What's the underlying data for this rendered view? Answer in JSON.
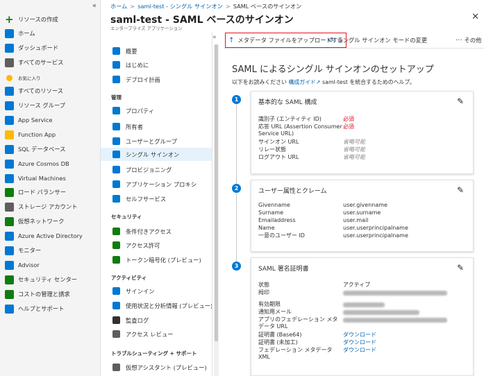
{
  "left_nav": {
    "collapse": "«",
    "items": [
      {
        "label": "リソースの作成",
        "icon": "plus-icon",
        "color": "#107c10"
      },
      {
        "label": "ホーム",
        "icon": "home-icon",
        "color": "#0078d4"
      },
      {
        "label": "ダッシュボード",
        "icon": "dashboard-icon",
        "color": "#0078d4"
      },
      {
        "label": "すべてのサービス",
        "icon": "list-icon",
        "color": "#605e5c"
      },
      {
        "label": "お気に入り",
        "icon": "star-icon",
        "color": "#ffb900"
      },
      {
        "label": "すべてのリソース",
        "icon": "grid-icon",
        "color": "#0078d4"
      },
      {
        "label": "リソース グループ",
        "icon": "resource-group-icon",
        "color": "#0078d4"
      },
      {
        "label": "App Service",
        "icon": "app-service-icon",
        "color": "#0078d4"
      },
      {
        "label": "Function App",
        "icon": "function-app-icon",
        "color": "#ffb900"
      },
      {
        "label": "SQL データベース",
        "icon": "sql-database-icon",
        "color": "#0078d4"
      },
      {
        "label": "Azure Cosmos DB",
        "icon": "cosmos-db-icon",
        "color": "#0078d4"
      },
      {
        "label": "Virtual Machines",
        "icon": "virtual-machine-icon",
        "color": "#0078d4"
      },
      {
        "label": "ロード バランサー",
        "icon": "load-balancer-icon",
        "color": "#107c10"
      },
      {
        "label": "ストレージ アカウント",
        "icon": "storage-account-icon",
        "color": "#605e5c"
      },
      {
        "label": "仮想ネットワーク",
        "icon": "virtual-network-icon",
        "color": "#107c10"
      },
      {
        "label": "Azure Active Directory",
        "icon": "active-directory-icon",
        "color": "#0078d4"
      },
      {
        "label": "モニター",
        "icon": "monitor-icon",
        "color": "#0078d4"
      },
      {
        "label": "Advisor",
        "icon": "advisor-icon",
        "color": "#0078d4"
      },
      {
        "label": "セキュリティ センター",
        "icon": "security-center-icon",
        "color": "#107c10"
      },
      {
        "label": "コストの管理と請求",
        "icon": "cost-management-icon",
        "color": "#107c10"
      },
      {
        "label": "ヘルプとサポート",
        "icon": "help-icon",
        "color": "#0078d4"
      }
    ]
  },
  "breadcrumb": [
    "ホーム",
    "saml-test - シングル サインオン",
    "SAML ベースのサインオン"
  ],
  "header": {
    "title": "saml-test - SAML ベースのサインオン",
    "subtitle": "エンタープライズ アプリケーション",
    "close": "✕"
  },
  "menu": {
    "collapse": "«",
    "items": [
      {
        "label": "概要",
        "icon": "grid-icon",
        "color": "#0078d4"
      },
      {
        "label": "はじめに",
        "icon": "rocket-icon",
        "color": "#0078d4"
      },
      {
        "label": "デプロイ計画",
        "icon": "book-icon",
        "color": "#0078d4"
      },
      {
        "label": "管理",
        "section": true
      },
      {
        "label": "プロパティ",
        "icon": "properties-icon",
        "color": "#0078d4"
      },
      {
        "label": "所有者",
        "icon": "owners-icon",
        "color": "#0078d4"
      },
      {
        "label": "ユーザーとグループ",
        "icon": "users-icon",
        "color": "#0078d4"
      },
      {
        "label": "シングル サインオン",
        "icon": "sso-icon",
        "color": "#0078d4",
        "active": true
      },
      {
        "label": "プロビジョニング",
        "icon": "provisioning-icon",
        "color": "#0078d4"
      },
      {
        "label": "アプリケーション プロキシ",
        "icon": "proxy-icon",
        "color": "#0078d4"
      },
      {
        "label": "セルフサービス",
        "icon": "self-service-icon",
        "color": "#0078d4"
      },
      {
        "label": "セキュリティ",
        "section": true
      },
      {
        "label": "条件付きアクセス",
        "icon": "conditional-access-icon",
        "color": "#107c10"
      },
      {
        "label": "アクセス許可",
        "icon": "permissions-icon",
        "color": "#107c10"
      },
      {
        "label": "トークン暗号化 (プレビュー)",
        "icon": "token-encryption-icon",
        "color": "#107c10"
      },
      {
        "label": "アクティビティ",
        "section": true
      },
      {
        "label": "サインイン",
        "icon": "sign-in-icon",
        "color": "#0078d4"
      },
      {
        "label": "使用状況と分析情報 (プレビュー)",
        "icon": "usage-chart-icon",
        "color": "#0078d4"
      },
      {
        "label": "監査ログ",
        "icon": "audit-log-icon",
        "color": "#323130"
      },
      {
        "label": "アクセス レビュー",
        "icon": "access-review-icon",
        "color": "#605e5c"
      },
      {
        "label": "トラブルシューティング + サポート",
        "section": true
      },
      {
        "label": "仮想アシスタント (プレビュー)",
        "icon": "assistant-icon",
        "color": "#605e5c"
      }
    ]
  },
  "toolbar": {
    "upload": {
      "icon": "↑",
      "label": "メタデータ ファイルをアップロードする"
    },
    "change_mode": {
      "icon": "↺",
      "label": "シングル サインオン モードの変更"
    },
    "more": {
      "icon": "···",
      "label": "その他"
    }
  },
  "main": {
    "title": "SAML によるシングル サインオンのセットアップ",
    "intro_prefix": "以下をお読みください ",
    "intro_link": "構成ガイド",
    "intro_link_icon": "↗",
    "intro_suffix": " saml-test を統合するためのヘルプ。",
    "pencil": "✎",
    "cards": [
      {
        "step": "1",
        "title": "基本的な SAML 構成",
        "rows": [
          {
            "label": "識別子 (エンティティ ID)",
            "value": "必須",
            "kind": "req"
          },
          {
            "label": "応答 URL (Assertion Consumer Service URL)",
            "value": "必須",
            "kind": "req"
          },
          {
            "label": "サインオン URL",
            "value": "省略可能",
            "kind": "opt"
          },
          {
            "label": "リレー状態",
            "value": "省略可能",
            "kind": "opt"
          },
          {
            "label": "ログアウト URL",
            "value": "省略可能",
            "kind": "opt"
          }
        ]
      },
      {
        "step": "2",
        "title": "ユーザー属性とクレーム",
        "rows": [
          {
            "label": "Givenname",
            "value": "user.givenname"
          },
          {
            "label": "Surname",
            "value": "user.surname"
          },
          {
            "label": "Emailaddress",
            "value": "user.mail"
          },
          {
            "label": "Name",
            "value": "user.userprincipalname"
          },
          {
            "label": "一意のユーザー ID",
            "value": "user.userprincipalname"
          }
        ]
      },
      {
        "step": "3",
        "title": "SAML 署名証明書",
        "rows": [
          {
            "label": "状態",
            "value": "アクティブ"
          },
          {
            "label": "拇印",
            "value": "",
            "kind": "blur"
          },
          {
            "label": "有効期限",
            "value": "",
            "kind": "blur"
          },
          {
            "label": "通知用メール",
            "value": "",
            "kind": "blur"
          },
          {
            "label": "アプリのフェデレーション メタデータ URL",
            "value": "",
            "kind": "blur"
          },
          {
            "label": "証明書 (Base64)",
            "value": "ダウンロード",
            "kind": "dl"
          },
          {
            "label": "証明書 (未加工)",
            "value": "ダウンロード",
            "kind": "dl"
          },
          {
            "label": "フェデレーション メタデータ XML",
            "value": "ダウンロード",
            "kind": "dl"
          }
        ]
      }
    ]
  }
}
